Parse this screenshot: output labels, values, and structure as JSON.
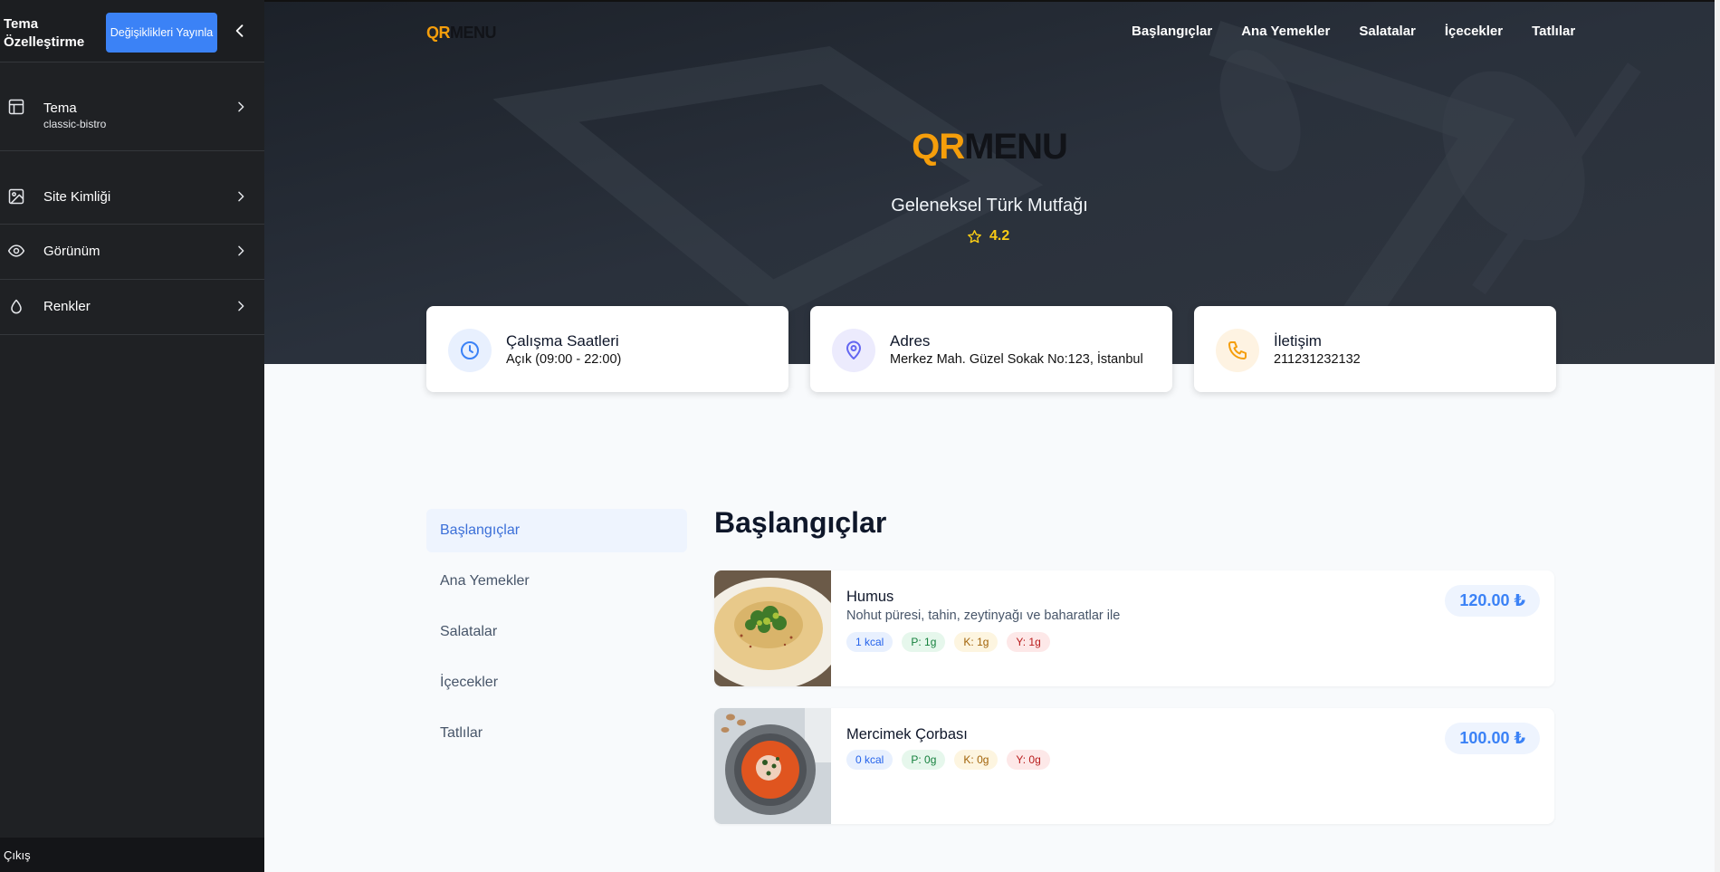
{
  "sidebar": {
    "title": "Tema Özelleştirme",
    "publish_label": "Değişiklikleri Yayınla",
    "items": [
      {
        "label": "Tema",
        "sub": "classic-bistro",
        "icon": "layout-icon"
      },
      {
        "label": "Site Kimliği",
        "icon": "image-icon"
      },
      {
        "label": "Görünüm",
        "icon": "eye-icon"
      },
      {
        "label": "Renkler",
        "icon": "droplet-icon"
      }
    ],
    "logout_label": "Çıkış"
  },
  "header": {
    "logo_part1": "QR",
    "logo_part2": "MENU",
    "nav": [
      "Başlangıçlar",
      "Ana Yemekler",
      "Salatalar",
      "İçecekler",
      "Tatlılar"
    ]
  },
  "hero": {
    "logo_part1": "QR",
    "logo_part2": "MENU",
    "subtitle": "Geleneksel Türk Mutfağı",
    "rating": "4.2"
  },
  "info_cards": [
    {
      "title": "Çalışma Saatleri",
      "value": "Açık (09:00 - 22:00)",
      "icon": "clock-icon",
      "color": "#3b82f6"
    },
    {
      "title": "Adres",
      "value": "Merkez Mah. Güzel Sokak No:123, İstanbul",
      "icon": "map-pin-icon",
      "color": "#6366f1"
    },
    {
      "title": "İletişim",
      "value": "211231232132",
      "icon": "phone-icon",
      "color": "#f59e0b"
    }
  ],
  "categories": [
    "Başlangıçlar",
    "Ana Yemekler",
    "Salatalar",
    "İçecekler",
    "Tatlılar"
  ],
  "active_category": "Başlangıçlar",
  "section_title": "Başlangıçlar",
  "menu_items": [
    {
      "name": "Humus",
      "description": "Nohut püresi, tahin, zeytinyağı ve baharatlar ile",
      "kcal": "1 kcal",
      "p": "P: 1g",
      "k": "K: 1g",
      "y": "Y: 1g",
      "price": "120.00 ₺"
    },
    {
      "name": "Mercimek Çorbası",
      "description": "",
      "kcal": "0 kcal",
      "p": "P: 0g",
      "k": "K: 0g",
      "y": "Y: 0g",
      "price": "100.00 ₺"
    }
  ],
  "colors": {
    "accent": "#3b82f6",
    "brand": "#f59e0b",
    "sidebar": "#1f2124",
    "hero": "#252b35"
  }
}
